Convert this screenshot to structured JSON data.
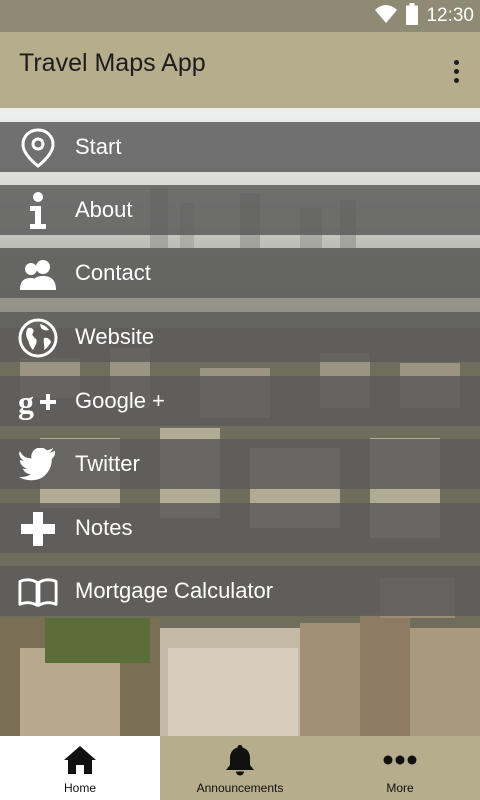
{
  "status_bar": {
    "time": "12:30",
    "icons": [
      "wifi-icon",
      "battery-icon"
    ]
  },
  "app_bar": {
    "title": "Travel Maps App",
    "menu_icon": "overflow-menu-icon"
  },
  "menu": {
    "items": [
      {
        "label": "Start",
        "icon": "map-pin-icon"
      },
      {
        "label": "About",
        "icon": "info-icon"
      },
      {
        "label": "Contact",
        "icon": "contacts-icon"
      },
      {
        "label": "Website",
        "icon": "globe-icon"
      },
      {
        "label": "Google +",
        "icon": "google-plus-icon"
      },
      {
        "label": "Twitter",
        "icon": "twitter-bird-icon"
      },
      {
        "label": "Notes",
        "icon": "plus-icon"
      },
      {
        "label": "Mortgage Calculator",
        "icon": "book-icon"
      }
    ]
  },
  "bottom_nav": {
    "tabs": [
      {
        "label": "Home",
        "icon": "home-icon",
        "active": true
      },
      {
        "label": "Announcements",
        "icon": "bell-icon",
        "active": false
      },
      {
        "label": "More",
        "icon": "more-dots-icon",
        "active": false
      }
    ]
  },
  "colors": {
    "app_bar": "#b5ad8c",
    "status_bar": "#8e8a73",
    "menu_item_bg": "#5c5c5c",
    "active_tab": "#ffffff"
  }
}
